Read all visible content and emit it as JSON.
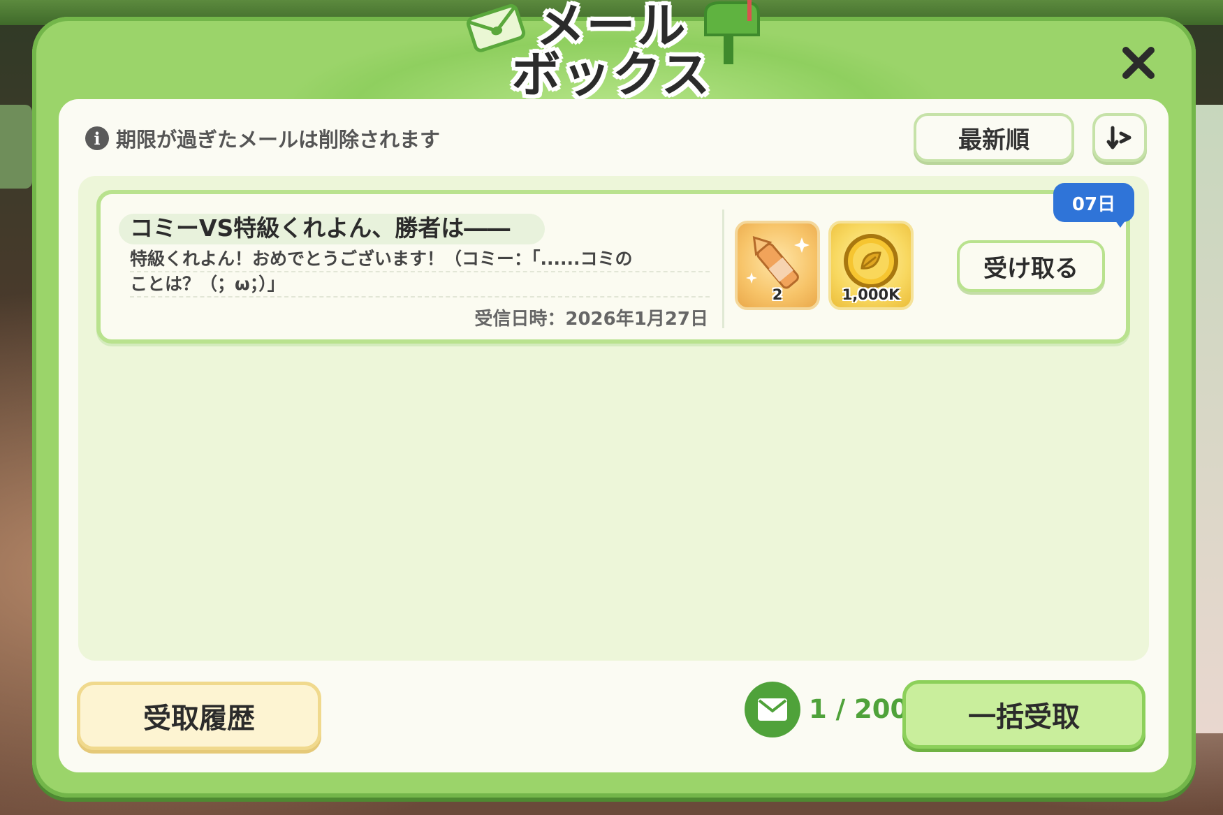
{
  "modal": {
    "title_line1": "メール",
    "title_line2": "ボックス",
    "close_icon": "close-icon"
  },
  "notice": {
    "icon": "info-icon",
    "text": "期限が過ぎたメールは削除されます"
  },
  "sort": {
    "label": "最新順",
    "order_icon": "sort-order-icon"
  },
  "mails": [
    {
      "title": "コミーVS特級くれよん、勝者は――",
      "body_line1": "特級くれよん！おめでとうございます！（コミー：「......コミの",
      "body_line2": "ことは？（；ω；）」",
      "date_label": "受信日時：",
      "date": "2026年1月27日",
      "expiry": "07日",
      "rewards": [
        {
          "icon": "crayon-item-icon",
          "qty": "2"
        },
        {
          "icon": "leaf-coin-icon",
          "qty": "1,000K"
        }
      ],
      "receive_label": "受け取る"
    }
  ],
  "footer": {
    "history_label": "受取履歴",
    "mail_icon": "envelope-icon",
    "count": "1 / 200",
    "claim_all_label": "一括受取"
  },
  "colors": {
    "frame_green": "#9bd46a",
    "panel": "#fbfbf3",
    "accent_green": "#4fa23a",
    "badge_blue": "#2f74d8",
    "history_yellow": "#fdf4d2"
  }
}
